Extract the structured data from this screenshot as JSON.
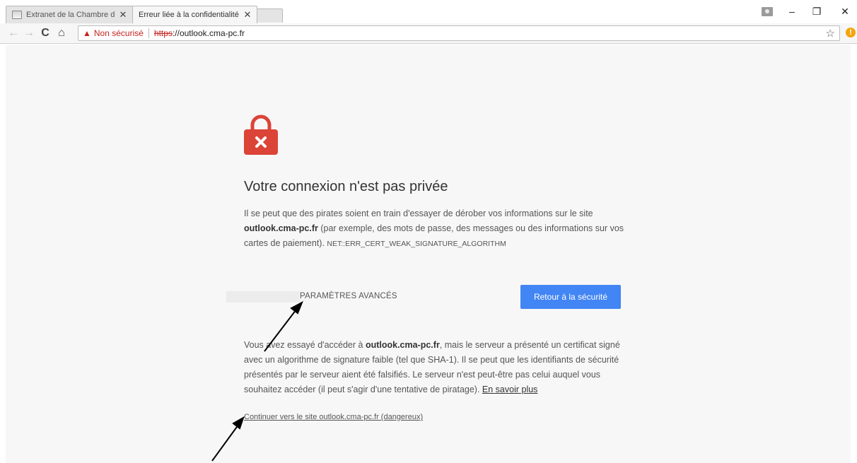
{
  "tabs": [
    {
      "title": "Extranet de la Chambre d",
      "close": "✕"
    },
    {
      "title": "Erreur liée à la confidentialité",
      "close": "✕"
    }
  ],
  "window_controls": {
    "minimize": "–",
    "maximize": "❐",
    "close": "✕"
  },
  "toolbar": {
    "back": "←",
    "forward": "→",
    "reload": "C",
    "home": "⌂",
    "star": "☆",
    "extension_badge": "!"
  },
  "omnibox": {
    "warning_icon": "▲",
    "security_label": "Non sécurisé",
    "scheme": "https",
    "host_rest": "://outlook.cma-pc.fr"
  },
  "interstitial": {
    "heading": "Votre connexion n'est pas privée",
    "para1_before": "Il se peut que des pirates soient en train d'essayer de dérober vos informations sur le site ",
    "para1_host": "outlook.cma-pc.fr",
    "para1_after": " (par exemple, des mots de passe, des messages ou des informations sur vos cartes de paiement). ",
    "error_code": "NET::ERR_CERT_WEAK_SIGNATURE_ALGORITHM",
    "advanced_label": "PARAMÈTRES AVANCÉS",
    "back_to_safety": "Retour à la sécurité",
    "para2_before": "Vous avez essayé d'accéder à ",
    "para2_host": "outlook.cma-pc.fr",
    "para2_after": ", mais le serveur a présenté un certificat signé avec un algorithme de signature faible (tel que SHA-1). Il se peut que les identifiants de sécurité présentés par le serveur aient été falsifiés. Le serveur n'est peut-être pas celui auquel vous souhaitez accéder (il peut s'agir d'une tentative de piratage). ",
    "learn_more": "En savoir plus",
    "proceed_link": "Continuer vers le site outlook.cma-pc.fr (dangereux)"
  },
  "colors": {
    "accent": "#4285f4",
    "danger": "#c5221f",
    "lock": "#db4437"
  }
}
